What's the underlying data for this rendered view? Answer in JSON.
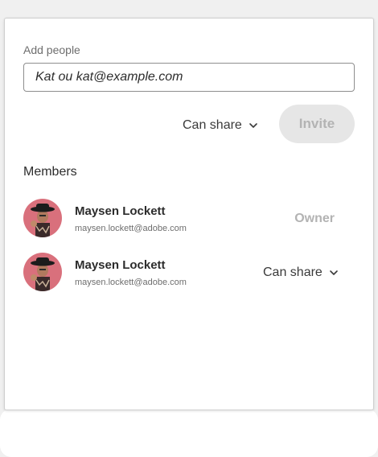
{
  "invite": {
    "add_label": "Add people",
    "input_value": "Kat ou kat@example.com",
    "permission": "Can share",
    "invite_label": "Invite"
  },
  "members": {
    "heading": "Members",
    "items": [
      {
        "name": "Maysen Lockett",
        "email": "maysen.lockett@adobe.com",
        "role": "Owner"
      },
      {
        "name": "Maysen Lockett",
        "email": "maysen.lockett@adobe.com",
        "role": "Can share"
      }
    ]
  },
  "colors": {
    "input_border": "#8e8e8e",
    "disabled_button_bg": "#e6e6e6",
    "disabled_text": "#b3b3b3",
    "avatar_bg": "#d9707c"
  },
  "icons": {
    "permission_dropdown": "chevron-down-icon"
  }
}
